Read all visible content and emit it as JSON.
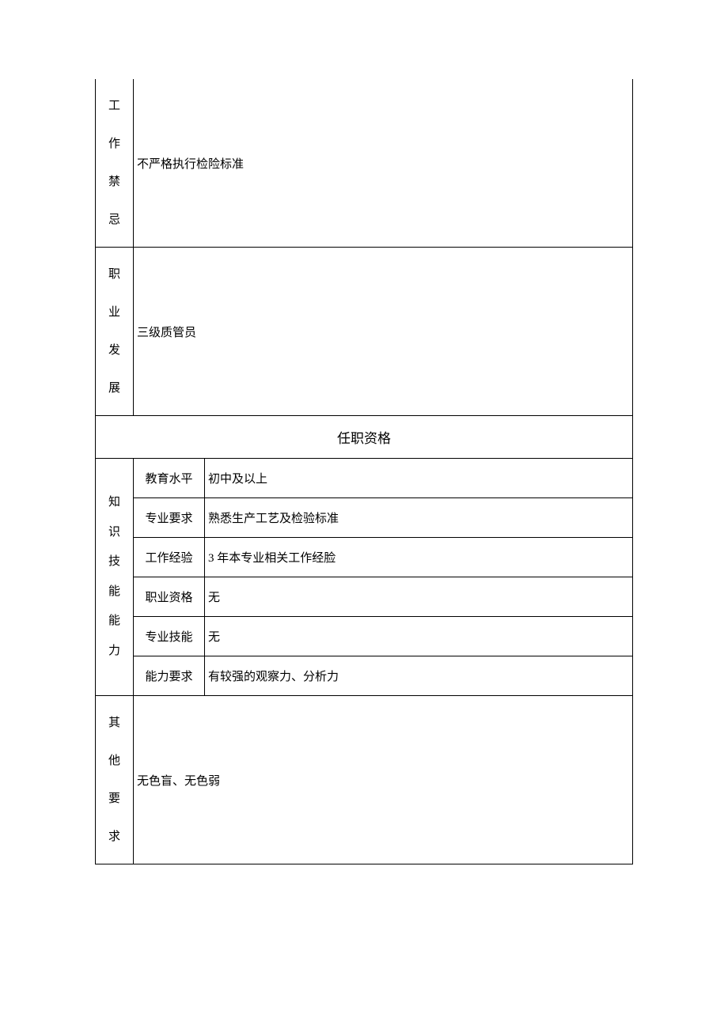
{
  "rows": {
    "work_prohibition": {
      "label": "工作禁忌",
      "value": "不严格执行检险标准"
    },
    "career_development": {
      "label": "职业发展",
      "value": "三级质管员"
    },
    "qualification_header": "任职资格",
    "knowledge_skill_ability": {
      "label": "知识技能能力"
    },
    "other_requirements": {
      "label": "其他要求",
      "value": "无色盲、无色弱"
    }
  },
  "qualifications": [
    {
      "label": "教育水平",
      "value": "初中及以上"
    },
    {
      "label": "专业要求",
      "value": "熟悉生产工艺及检验标准"
    },
    {
      "label": "工作经验",
      "value": "3 年本专业相关工作经脸"
    },
    {
      "label": "职业资格",
      "value": "无"
    },
    {
      "label": "专业技能",
      "value": "无"
    },
    {
      "label": "能力要求",
      "value": "有较强的观察力、分析力"
    }
  ]
}
